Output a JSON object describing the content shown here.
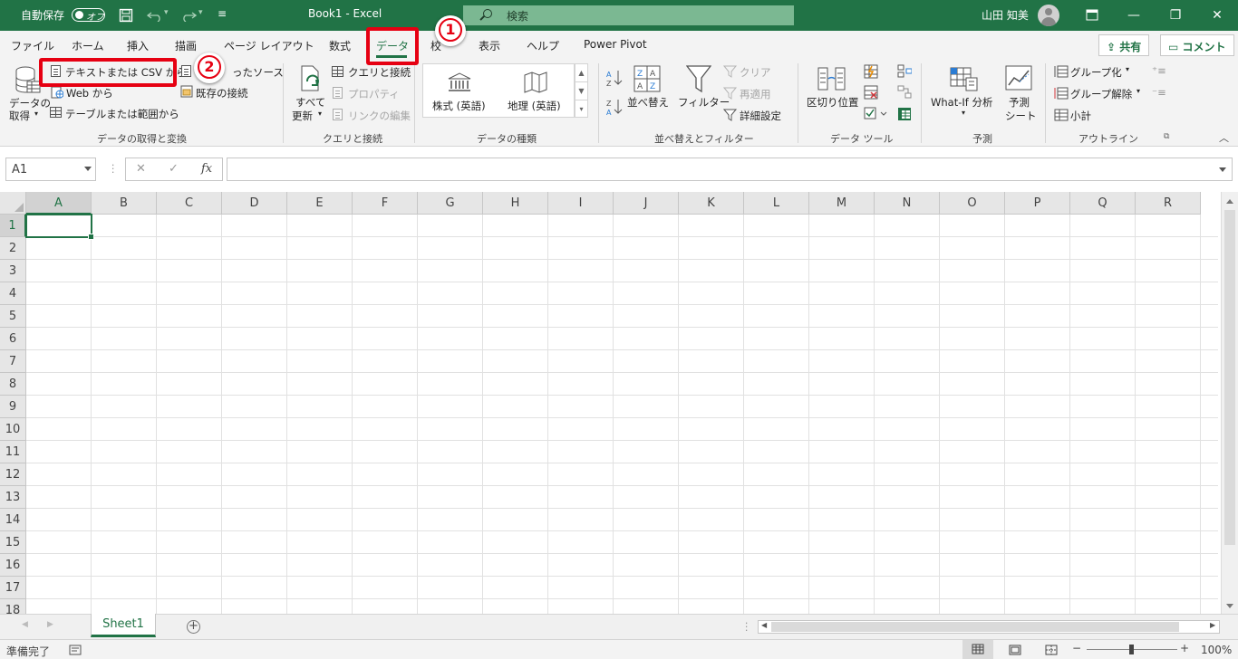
{
  "titlebar": {
    "autosave_label": "自動保存",
    "autosave_state": "オフ",
    "doc_title": "Book1 - Excel",
    "search_placeholder": "検索",
    "user_name": "山田 知美"
  },
  "ribbon_tabs": {
    "file": "ファイル",
    "home": "ホーム",
    "insert": "挿入",
    "draw": "描画",
    "page_layout": "ページ レイアウト",
    "formulas": "数式",
    "data": "データ",
    "review": "校",
    "view": "表示",
    "help": "ヘルプ",
    "power_pivot": "Power Pivot",
    "share": "共有",
    "comment": "コメント"
  },
  "ribbon": {
    "get_data": {
      "big_button_line1": "データの",
      "big_button_line2": "取得",
      "from_text_csv": "テキストまたは CSV から",
      "from_web": "Web から",
      "from_table": "テーブルまたは範囲から",
      "recent_sources": "ったソース",
      "existing_connections": "既存の接続",
      "group_label": "データの取得と変換"
    },
    "queries": {
      "refresh_all_line1": "すべて",
      "refresh_all_line2": "更新",
      "queries_connections": "クエリと接続",
      "properties": "プロパティ",
      "edit_links": "リンクの編集",
      "group_label": "クエリと接続"
    },
    "data_types": {
      "stocks": "株式 (英語)",
      "geography": "地理 (英語)",
      "group_label": "データの種類"
    },
    "sort_filter": {
      "sort": "並べ替え",
      "filter": "フィルター",
      "clear": "クリア",
      "reapply": "再適用",
      "advanced": "詳細設定",
      "group_label": "並べ替えとフィルター"
    },
    "data_tools": {
      "text_to_columns": "区切り位置",
      "group_label": "データ ツール"
    },
    "forecast": {
      "what_if": "What-If 分析",
      "forecast_sheet_line1": "予測",
      "forecast_sheet_line2": "シート",
      "group_label": "予測"
    },
    "outline": {
      "group": "グループ化",
      "ungroup": "グループ解除",
      "subtotal": "小計",
      "group_label": "アウトライン"
    }
  },
  "formula_bar": {
    "name_box": "A1",
    "cancel": "✕",
    "enter": "✓",
    "fx": "fx",
    "formula": ""
  },
  "grid": {
    "columns": [
      "A",
      "B",
      "C",
      "D",
      "E",
      "F",
      "G",
      "H",
      "I",
      "J",
      "K",
      "L",
      "M",
      "N",
      "O",
      "P",
      "Q",
      "R"
    ],
    "rows": [
      "1",
      "2",
      "3",
      "4",
      "5",
      "6",
      "7",
      "8",
      "9",
      "10",
      "11",
      "12",
      "13",
      "14",
      "15",
      "16",
      "17",
      "18"
    ],
    "selected_cell": "A1"
  },
  "sheets": {
    "active_sheet": "Sheet1",
    "add_sheet": "⊕"
  },
  "status": {
    "ready": "準備完了",
    "zoom": "100%"
  },
  "annotations": {
    "step1": "1",
    "step2": "2",
    "highlight_color": "#e60012"
  },
  "colors": {
    "accent": "#217346"
  }
}
